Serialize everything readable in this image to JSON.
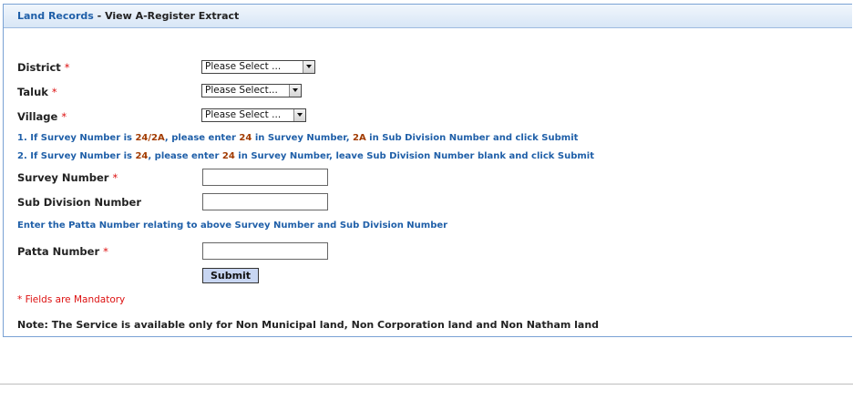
{
  "header": {
    "link": "Land Records",
    "separator": " - ",
    "title": "View A-Register Extract"
  },
  "required_mark": "*",
  "form": {
    "district": {
      "label": "District",
      "selected": "Please Select ..."
    },
    "taluk": {
      "label": "Taluk",
      "selected": "Please Select..."
    },
    "village": {
      "label": "Village",
      "selected": "Please Select ..."
    },
    "instructions": {
      "line1": {
        "a": "1. If Survey Number is ",
        "n1": "24/2A",
        "b": ", please enter ",
        "n2": "24",
        "c": " in Survey Number, ",
        "n3": "2A",
        "d": " in Sub Division Number and click Submit"
      },
      "line2": {
        "a": "2. If Survey Number is ",
        "n1": "24",
        "b": ", please enter ",
        "n2": "24",
        "c": " in Survey Number, leave Sub Division Number blank and click Submit"
      }
    },
    "survey_number": {
      "label": "Survey Number",
      "value": ""
    },
    "sub_division_number": {
      "label": "Sub Division Number",
      "value": ""
    },
    "patta_instruction": "Enter the Patta Number relating to above Survey Number and Sub Division Number",
    "patta_number": {
      "label": "Patta Number",
      "value": ""
    },
    "submit_label": "Submit"
  },
  "mandatory_note": "* Fields are Mandatory",
  "service_note": "Note: The Service is available only for Non Municipal land, Non Corporation land and Non Natham land",
  "colors": {
    "link_blue": "#1f5fa8",
    "required_red": "#d11111",
    "number_brown": "#a23b00",
    "button_fill": "#c8d6f2"
  }
}
